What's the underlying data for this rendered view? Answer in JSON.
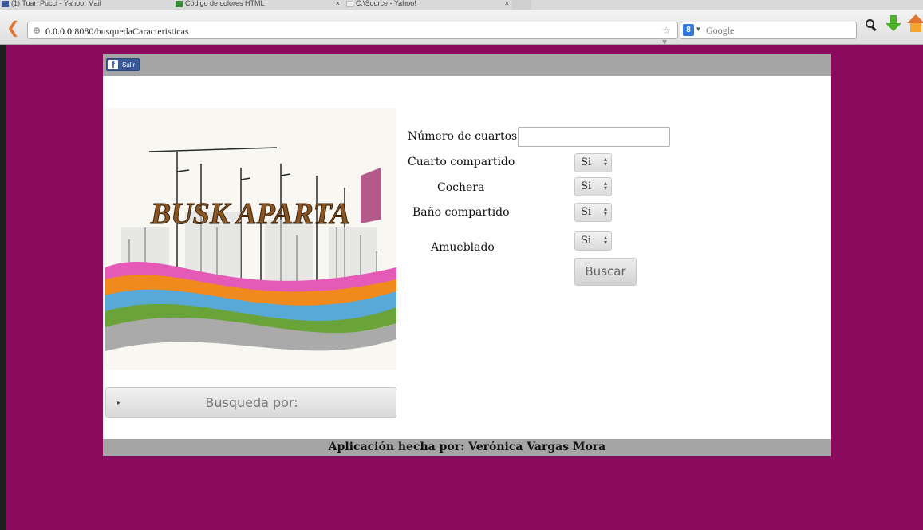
{
  "browser": {
    "tabs": [
      {
        "label": "(1) Tuan Pucci - Yahoo! Mail"
      },
      {
        "label": "Código de colores HTML"
      },
      {
        "label": "C:\\Source - Yahoo!"
      }
    ],
    "url_host": "0.0.0.0",
    "url_rest": ":8080/busquedaCaracteristicas",
    "search_engine_icon": "8",
    "search_placeholder": "Google"
  },
  "header": {
    "facebook_label": "Salir"
  },
  "logo": {
    "text": "BUSK APARTA"
  },
  "sidebar": {
    "search_by_label": "Busqueda por:"
  },
  "form": {
    "num_rooms_label": "Número de cuartos",
    "num_rooms_value": "",
    "shared_room_label": "Cuarto compartido",
    "shared_room_value": "Si",
    "garage_label": "Cochera",
    "garage_value": "Si",
    "shared_bath_label": "Baño compartido",
    "shared_bath_value": "Si",
    "furnished_label": "Amueblado",
    "furnished_value": "Si",
    "search_button": "Buscar"
  },
  "footer": {
    "text": "Aplicación hecha por: Verónica Vargas Mora"
  },
  "colors": {
    "page_background": "#8a0a5e",
    "bar_gray": "#a5a5a5",
    "facebook_blue": "#3b5998"
  }
}
